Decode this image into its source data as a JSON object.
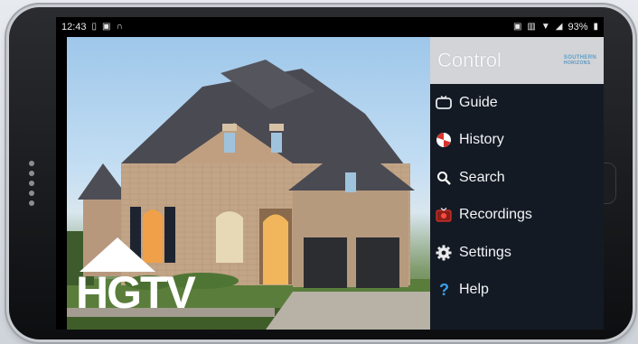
{
  "status_bar": {
    "time": "12:43",
    "battery": "93%"
  },
  "channel": {
    "logo_text": "HGTV"
  },
  "menu": {
    "title": "Control",
    "brand_line1": "SOUTHERN",
    "brand_line2": "HORIZONS",
    "items": [
      {
        "label": "Guide",
        "icon": "tv-icon"
      },
      {
        "label": "History",
        "icon": "history-icon"
      },
      {
        "label": "Search",
        "icon": "search-icon"
      },
      {
        "label": "Recordings",
        "icon": "recordings-icon"
      },
      {
        "label": "Settings",
        "icon": "gear-icon"
      },
      {
        "label": "Help",
        "icon": "help-icon"
      }
    ]
  },
  "colors": {
    "menu_bg": "#141a24",
    "menu_header_bg": "#d2d4d7",
    "accent_red": "#d9342b",
    "accent_blue": "#3aa0e8"
  }
}
